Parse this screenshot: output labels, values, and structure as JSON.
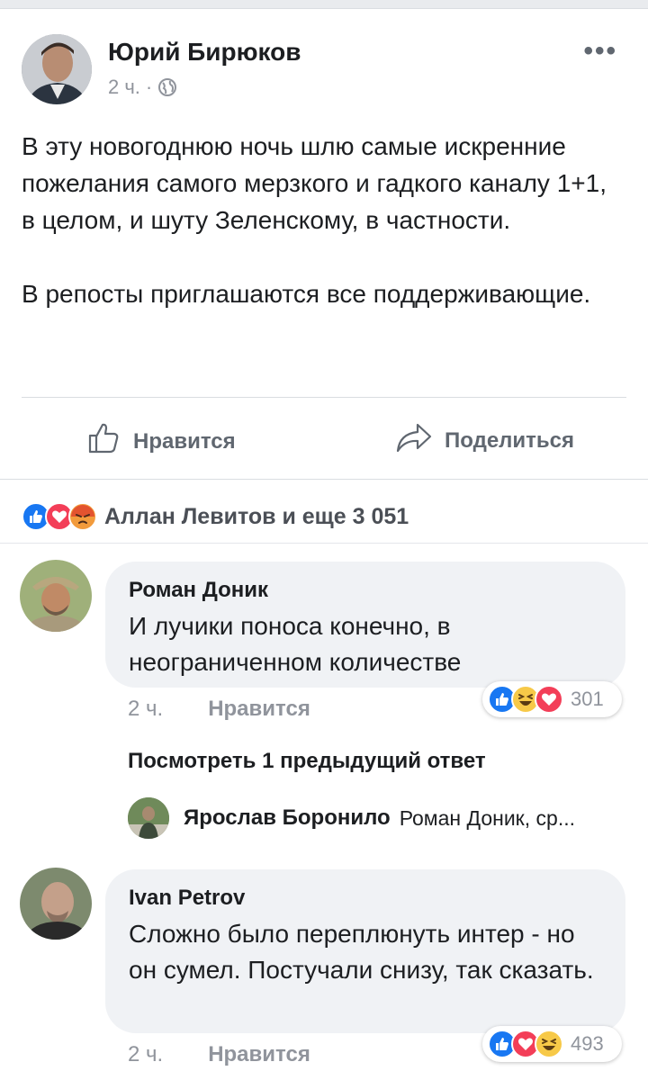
{
  "post": {
    "author": "Юрий Бирюков",
    "time": "2 ч.",
    "separator": "·",
    "more": "•••",
    "paragraphs": [
      "В эту новогоднюю ночь шлю самые искренние пожелания самого мерзкого и гадкого каналу 1+1, в целом, и шуту Зеленскому, в частности.",
      "В репосты приглашаются все поддерживающие."
    ]
  },
  "actions": {
    "like_label": "Нравится",
    "share_label": "Поделиться"
  },
  "reactions": {
    "summary": "Аллан Левитов и еще 3 051",
    "icons": [
      "like-icon",
      "love-icon",
      "angry-icon"
    ]
  },
  "comments": [
    {
      "name": "Роман Доник",
      "text": "И лучики поноса конечно, в неограниченном количестве",
      "time": "2 ч.",
      "like_label": "Нравится",
      "reaction_count": "301",
      "reaction_icons": [
        "like-icon",
        "haha-icon",
        "love-icon"
      ]
    },
    {
      "name": "Ivan Petrov",
      "text": "Сложно было переплюнуть интер - но он сумел. Постучали снизу, так сказать.",
      "time": "2 ч.",
      "like_label": "Нравится",
      "reaction_count": "493",
      "reaction_icons": [
        "like-icon",
        "love-icon",
        "haha-icon"
      ]
    }
  ],
  "view_more_replies": "Посмотреть 1 предыдущий ответ",
  "reply": {
    "name": "Ярослав Боронило",
    "text": "Роман Доник, ср..."
  },
  "colors": {
    "like_blue": "#1877f2",
    "love_red": "#f33e58",
    "angry_orange": "#f29b3c",
    "haha_yellow": "#f7c948",
    "muted_text": "#90949c",
    "bubble_bg": "#f0f2f5"
  }
}
